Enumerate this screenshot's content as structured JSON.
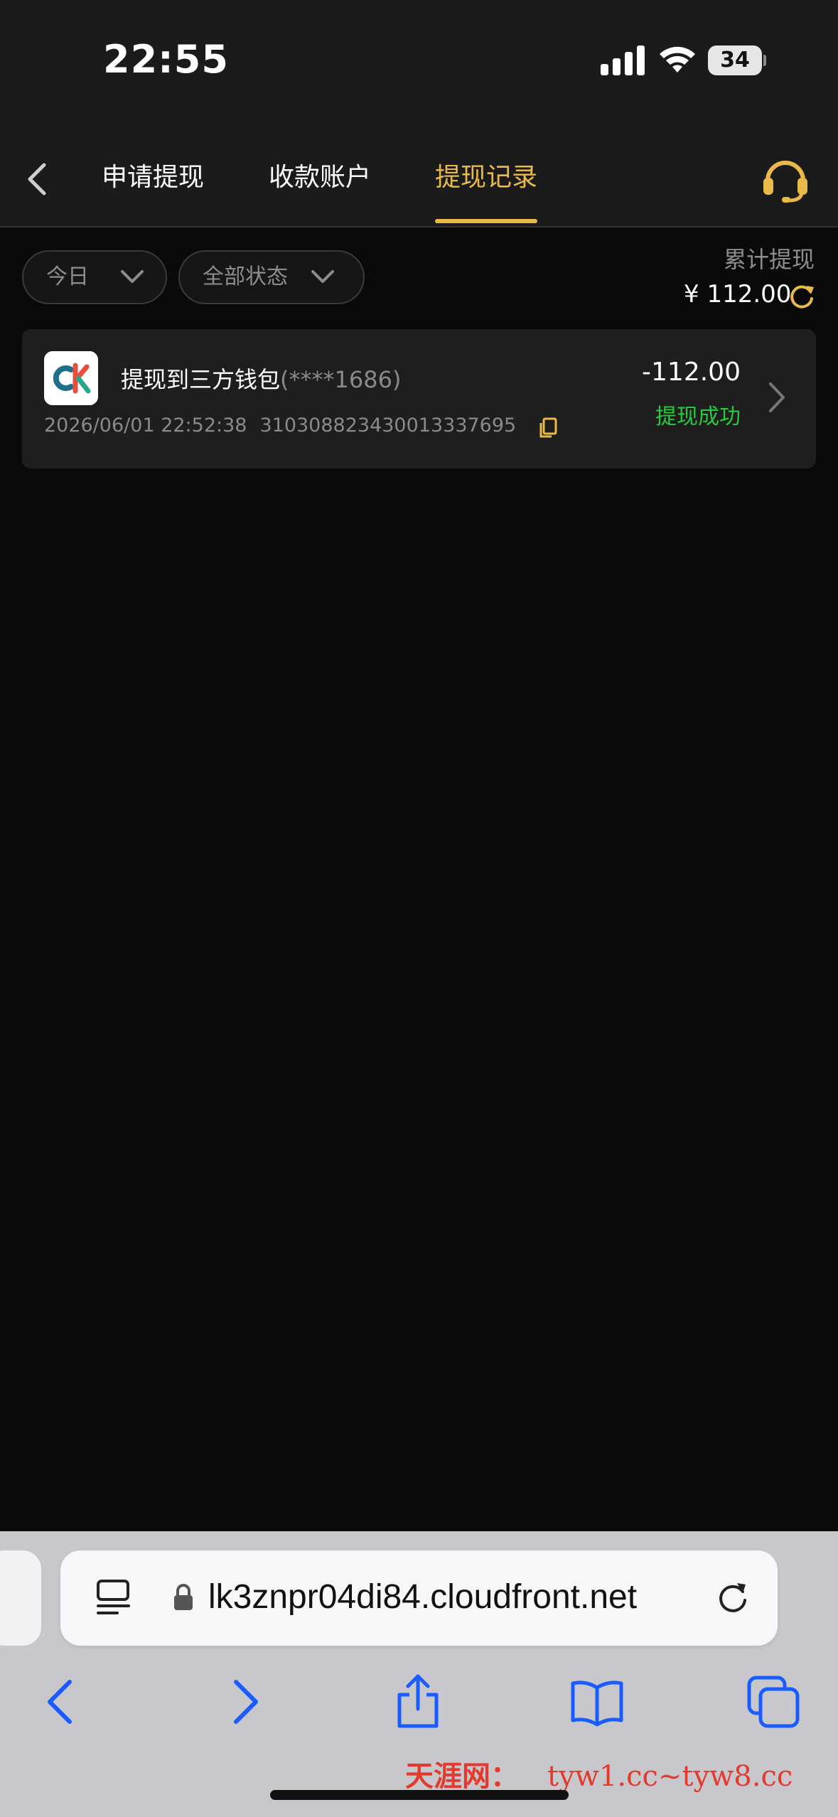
{
  "status_bar": {
    "time": "22:55",
    "battery": "34"
  },
  "nav": {
    "tabs": [
      {
        "label": "申请提现",
        "active": false
      },
      {
        "label": "收款账户",
        "active": false
      },
      {
        "label": "提现记录",
        "active": true
      }
    ],
    "accent_color": "#e9b949"
  },
  "filters": {
    "date_label": "今日",
    "status_label": "全部状态"
  },
  "summary": {
    "total_label": "累计提现",
    "total_value": "¥ 112.00"
  },
  "records": [
    {
      "title": "提现到三方钱包",
      "account": "(****1686)",
      "datetime": "2026/06/01 22:52:38",
      "order_no": "310308823430013337695",
      "amount": "-112.00",
      "status": "提现成功",
      "status_color": "#28c840"
    }
  ],
  "browser": {
    "url": "lk3znpr04di84.cloudfront.net"
  },
  "watermark": {
    "brand": "天涯网：",
    "domains": "tyw1.cc~tyw8.cc"
  },
  "icons": [
    "signal-icon",
    "wifi-icon",
    "battery-icon",
    "back-icon",
    "headset-icon",
    "chevron-down-icon",
    "refresh-icon",
    "wallet-logo",
    "copy-icon",
    "chevron-right-icon",
    "reader-icon",
    "lock-icon",
    "reload-icon",
    "browser-back-icon",
    "browser-forward-icon",
    "share-icon",
    "bookmarks-icon",
    "tabs-icon"
  ]
}
